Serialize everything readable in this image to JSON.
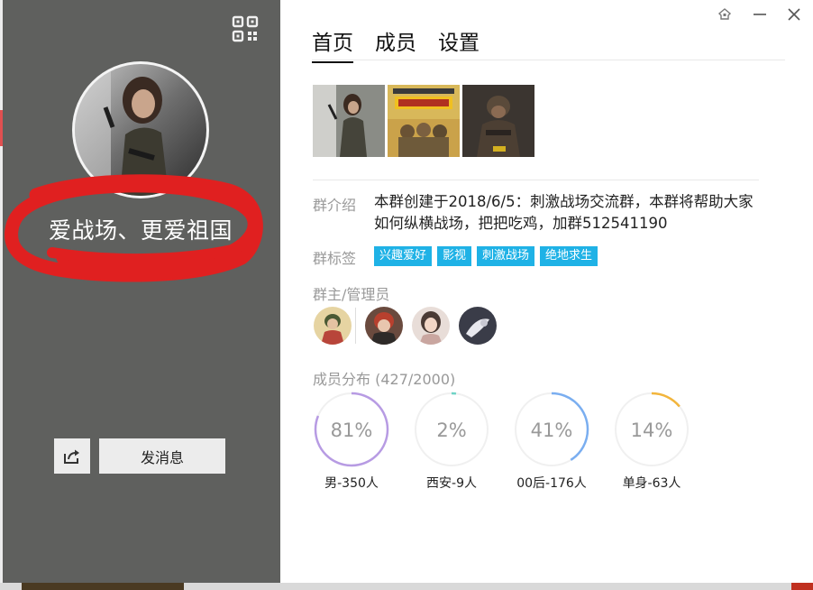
{
  "left_panel": {
    "group_name": "爱战场、更爱祖国",
    "send_message_label": "发消息"
  },
  "tabs": [
    {
      "label": "首页",
      "active": true
    },
    {
      "label": "成员",
      "active": false
    },
    {
      "label": "设置",
      "active": false
    }
  ],
  "intro": {
    "label": "群介绍",
    "text": "本群创建于2018/6/5：刺激战场交流群，本群将帮助大家如何纵横战场，把把吃鸡，加群512541190"
  },
  "tags": {
    "label": "群标签",
    "items": [
      "兴趣爱好",
      "影视",
      "刺激战场",
      "绝地求生"
    ]
  },
  "admins": {
    "label": "群主/管理员"
  },
  "distribution": {
    "label": "成员分布",
    "count": "(427/2000)",
    "items": [
      {
        "percent_text": "81%",
        "value": 0.81,
        "label": "男-350人",
        "color": "#b79be3"
      },
      {
        "percent_text": "2%",
        "value": 0.02,
        "label": "西安-9人",
        "color": "#6fd3c6"
      },
      {
        "percent_text": "41%",
        "value": 0.41,
        "label": "00后-176人",
        "color": "#7aaef0"
      },
      {
        "percent_text": "14%",
        "value": 0.14,
        "label": "单身-63人",
        "color": "#f2b53c"
      }
    ]
  },
  "colors": {
    "left_panel_bg": "#5f605e",
    "tag_bg": "#1fb2e6",
    "scribble": "#e02020"
  }
}
